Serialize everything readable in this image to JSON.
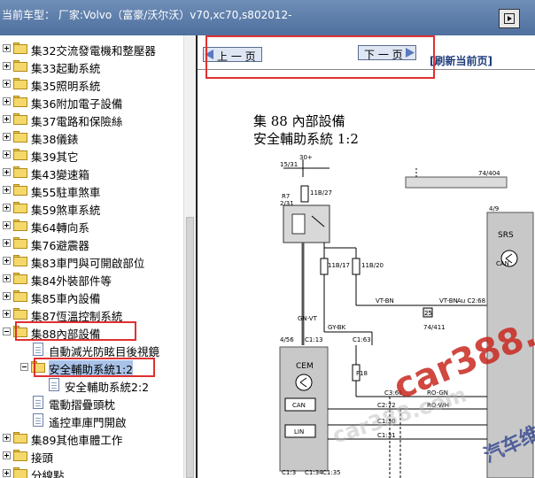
{
  "header": {
    "title": "当前车型：  厂家:Volvo（富豪/沃尔沃）v70,xc70,s802012-"
  },
  "navigation": {
    "prev_label": "上 一 页",
    "next_label": "下 一 页",
    "refresh_label": "[刷新当前页]"
  },
  "tree": [
    {
      "label": "集32交流發電機和整壓器",
      "kind": "folder",
      "expander": "plus"
    },
    {
      "label": "集33起動系統",
      "kind": "folder",
      "expander": "plus"
    },
    {
      "label": "集35照明系統",
      "kind": "folder",
      "expander": "plus"
    },
    {
      "label": "集36附加電子設備",
      "kind": "folder",
      "expander": "plus"
    },
    {
      "label": "集37電路和保險絲",
      "kind": "folder",
      "expander": "plus"
    },
    {
      "label": "集38儀錶",
      "kind": "folder",
      "expander": "plus"
    },
    {
      "label": "集39其它",
      "kind": "folder",
      "expander": "plus"
    },
    {
      "label": "集43變速箱",
      "kind": "folder",
      "expander": "plus"
    },
    {
      "label": "集55駐車煞車",
      "kind": "folder",
      "expander": "plus"
    },
    {
      "label": "集59煞車系統",
      "kind": "folder",
      "expander": "plus"
    },
    {
      "label": "集64轉向系",
      "kind": "folder",
      "expander": "plus"
    },
    {
      "label": "集76避震器",
      "kind": "folder",
      "expander": "plus"
    },
    {
      "label": "集83車門與可開啟部位",
      "kind": "folder",
      "expander": "plus"
    },
    {
      "label": "集84外裝部件等",
      "kind": "folder",
      "expander": "plus"
    },
    {
      "label": "集85車內設備",
      "kind": "folder",
      "expander": "plus"
    },
    {
      "label": "集87恆溫控制系統",
      "kind": "folder",
      "expander": "plus"
    },
    {
      "label": "集88內部設備",
      "kind": "folder",
      "expander": "minus"
    },
    {
      "label": "自動減光防眩目後視鏡",
      "kind": "doc",
      "expander": ""
    },
    {
      "label": "安全輔助系統1:2",
      "kind": "folder",
      "expander": "minus",
      "selected": true
    },
    {
      "label": "安全輔助系統2:2",
      "kind": "doc",
      "expander": ""
    },
    {
      "label": "電動摺疊頭枕",
      "kind": "doc",
      "expander": ""
    },
    {
      "label": "遙控車庫門開啟",
      "kind": "doc",
      "expander": ""
    },
    {
      "label": "集89其他車體工作",
      "kind": "folder",
      "expander": "plus"
    },
    {
      "label": "接頭",
      "kind": "folder",
      "expander": "plus"
    },
    {
      "label": "分線點",
      "kind": "folder",
      "expander": "plus"
    }
  ],
  "diagram": {
    "title_line1": "集 88 內部設備",
    "title_line2": "安全輔助系統 1:2",
    "labels": {
      "l_1531": "15/31",
      "l_30": "30+",
      "l_r7": "R7",
      "l_231": "2/31",
      "l_11b27": "11B/27",
      "l_11b17": "11B/17",
      "l_11b20": "11B/20",
      "l_74404": "74/404",
      "l_49": "4/9",
      "l_srs": "SRS",
      "l_vtbn": "VT-BN",
      "l_25": "25",
      "l_vtbn2": "VT-BN",
      "l_auc": "Au C2:68",
      "l_74411": "74/411",
      "l_gyvt": "GN-VT",
      "l_gybk": "GY-BK",
      "l_456": "4/56",
      "l_c113": "C1:13",
      "l_c163": "C1:63",
      "l_cem": "CEM",
      "l_can": "CAN",
      "l_lin": "LIN",
      "l_f18": "F18",
      "l_c366": "C3:66",
      "l_c272": "C2:72",
      "l_c130": "C1:30",
      "l_c131": "C1:31",
      "l_rogn": "RO-GN",
      "l_rd": "RO-WH",
      "l_c13": "C1:3",
      "l_c134": "C1:34",
      "l_c135": "C1:35",
      "l_can2": "CAN"
    }
  },
  "watermark": {
    "text1": "car388.c",
    "text2": "car388.com",
    "text3": "汽车维修"
  },
  "colors": {
    "highlight_red": "#e03030",
    "selection_blue": "#a9c2e8",
    "header_blue": "#5a7aa8"
  }
}
